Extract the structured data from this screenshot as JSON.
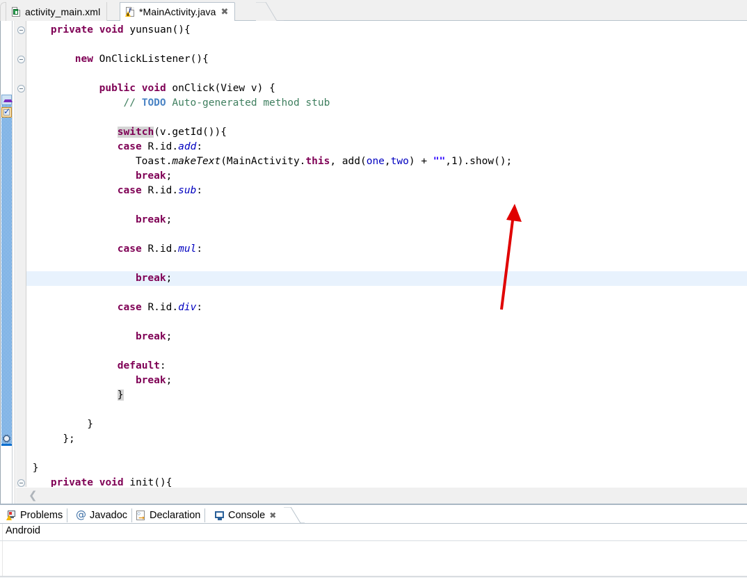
{
  "window": {
    "app": "Eclipse IDE",
    "accent_color": "#0d6fcf",
    "annotation_arrow_color": "#e00000"
  },
  "editor_tabs": [
    {
      "label": "activity_main.xml",
      "icon": "xml-file-icon",
      "active": false,
      "dirty": false,
      "closable": false
    },
    {
      "label": "*MainActivity.java",
      "icon": "java-file-warning-icon",
      "active": true,
      "dirty": true,
      "closable": true,
      "close_glyph": "✖"
    }
  ],
  "editor": {
    "current_line_number": 19,
    "highlight_color": "#e8f2fd",
    "code_lines": [
      {
        "indent": 4,
        "tokens": [
          {
            "t": "private",
            "c": "kw"
          },
          {
            "t": " ",
            "c": "plain"
          },
          {
            "t": "void",
            "c": "kw"
          },
          {
            "t": " yunsuan(){",
            "c": "plain"
          }
        ],
        "fold": true
      },
      {
        "indent": 0,
        "tokens": []
      },
      {
        "indent": 8,
        "tokens": [
          {
            "t": "new",
            "c": "kw"
          },
          {
            "t": " OnClickListener(){",
            "c": "plain"
          }
        ],
        "fold": true
      },
      {
        "indent": 0,
        "tokens": []
      },
      {
        "indent": 12,
        "tokens": [
          {
            "t": "public",
            "c": "kw"
          },
          {
            "t": " ",
            "c": "plain"
          },
          {
            "t": "void",
            "c": "kw"
          },
          {
            "t": " onClick(View v) {",
            "c": "plain"
          }
        ],
        "fold": true
      },
      {
        "indent": 16,
        "tokens": [
          {
            "t": "// ",
            "c": "cmt"
          },
          {
            "t": "TODO",
            "c": "todo"
          },
          {
            "t": " Auto-generated method stub",
            "c": "cmt"
          }
        ]
      },
      {
        "indent": 0,
        "tokens": []
      },
      {
        "indent": 15,
        "tokens": [
          {
            "t": "switch",
            "c": "kw hl"
          },
          {
            "t": "(v.getId()){",
            "c": "plain"
          }
        ]
      },
      {
        "indent": 15,
        "tokens": [
          {
            "t": "case",
            "c": "kw"
          },
          {
            "t": " R.id.",
            "c": "plain"
          },
          {
            "t": "add",
            "c": "stat"
          },
          {
            "t": ":",
            "c": "plain"
          }
        ]
      },
      {
        "indent": 18,
        "tokens": [
          {
            "t": "Toast.",
            "c": "plain"
          },
          {
            "t": "makeText",
            "c": "mth"
          },
          {
            "t": "(MainActivity.",
            "c": "plain"
          },
          {
            "t": "this",
            "c": "kw"
          },
          {
            "t": ", add(",
            "c": "plain"
          },
          {
            "t": "one",
            "c": "fld"
          },
          {
            "t": ",",
            "c": "plain"
          },
          {
            "t": "two",
            "c": "fld"
          },
          {
            "t": ") + ",
            "c": "plain"
          },
          {
            "t": "\"\"",
            "c": "str"
          },
          {
            "t": ",1).show();",
            "c": "plain"
          }
        ]
      },
      {
        "indent": 18,
        "tokens": [
          {
            "t": "break",
            "c": "kw"
          },
          {
            "t": ";",
            "c": "plain"
          }
        ]
      },
      {
        "indent": 15,
        "tokens": [
          {
            "t": "case",
            "c": "kw"
          },
          {
            "t": " R.id.",
            "c": "plain"
          },
          {
            "t": "sub",
            "c": "stat"
          },
          {
            "t": ":",
            "c": "plain"
          }
        ]
      },
      {
        "indent": 0,
        "tokens": []
      },
      {
        "indent": 18,
        "tokens": [
          {
            "t": "break",
            "c": "kw"
          },
          {
            "t": ";",
            "c": "plain"
          }
        ]
      },
      {
        "indent": 0,
        "tokens": []
      },
      {
        "indent": 15,
        "tokens": [
          {
            "t": "case",
            "c": "kw"
          },
          {
            "t": " R.id.",
            "c": "plain"
          },
          {
            "t": "mul",
            "c": "stat"
          },
          {
            "t": ":",
            "c": "plain"
          }
        ]
      },
      {
        "indent": 0,
        "tokens": []
      },
      {
        "indent": 18,
        "tokens": [
          {
            "t": "break",
            "c": "kw"
          },
          {
            "t": ";",
            "c": "plain"
          }
        ],
        "current": true
      },
      {
        "indent": 0,
        "tokens": []
      },
      {
        "indent": 15,
        "tokens": [
          {
            "t": "case",
            "c": "kw"
          },
          {
            "t": " R.id.",
            "c": "plain"
          },
          {
            "t": "div",
            "c": "stat"
          },
          {
            "t": ":",
            "c": "plain"
          }
        ]
      },
      {
        "indent": 0,
        "tokens": []
      },
      {
        "indent": 18,
        "tokens": [
          {
            "t": "break",
            "c": "kw"
          },
          {
            "t": ";",
            "c": "plain"
          }
        ]
      },
      {
        "indent": 0,
        "tokens": []
      },
      {
        "indent": 15,
        "tokens": [
          {
            "t": "default",
            "c": "kw"
          },
          {
            "t": ":",
            "c": "plain"
          }
        ]
      },
      {
        "indent": 18,
        "tokens": [
          {
            "t": "break",
            "c": "kw"
          },
          {
            "t": ";",
            "c": "plain"
          }
        ]
      },
      {
        "indent": 15,
        "tokens": [
          {
            "t": "}",
            "c": "plain brm"
          }
        ]
      },
      {
        "indent": 0,
        "tokens": []
      },
      {
        "indent": 10,
        "tokens": [
          {
            "t": "}",
            "c": "plain"
          }
        ]
      },
      {
        "indent": 6,
        "tokens": [
          {
            "t": "};",
            "c": "plain"
          }
        ]
      },
      {
        "indent": 0,
        "tokens": []
      },
      {
        "indent": 1,
        "tokens": [
          {
            "t": "}",
            "c": "plain"
          }
        ]
      },
      {
        "indent": 4,
        "tokens": [
          {
            "t": "private",
            "c": "kw"
          },
          {
            "t": " ",
            "c": "plain"
          },
          {
            "t": "void",
            "c": "kw"
          },
          {
            "t": " init(){",
            "c": "plain"
          }
        ],
        "fold": true
      }
    ],
    "scroll_left_chevron": "❮"
  },
  "bottom_tabs": [
    {
      "label": "Problems",
      "icon": "problems-icon",
      "active": false,
      "closable": false
    },
    {
      "label": "Javadoc",
      "icon": "javadoc-icon",
      "active": false,
      "closable": false
    },
    {
      "label": "Declaration",
      "icon": "declaration-icon",
      "active": false,
      "closable": false
    },
    {
      "label": "Console",
      "icon": "console-icon",
      "active": true,
      "closable": true,
      "close_glyph": "✖"
    }
  ],
  "console": {
    "title": "Android",
    "output": ""
  }
}
